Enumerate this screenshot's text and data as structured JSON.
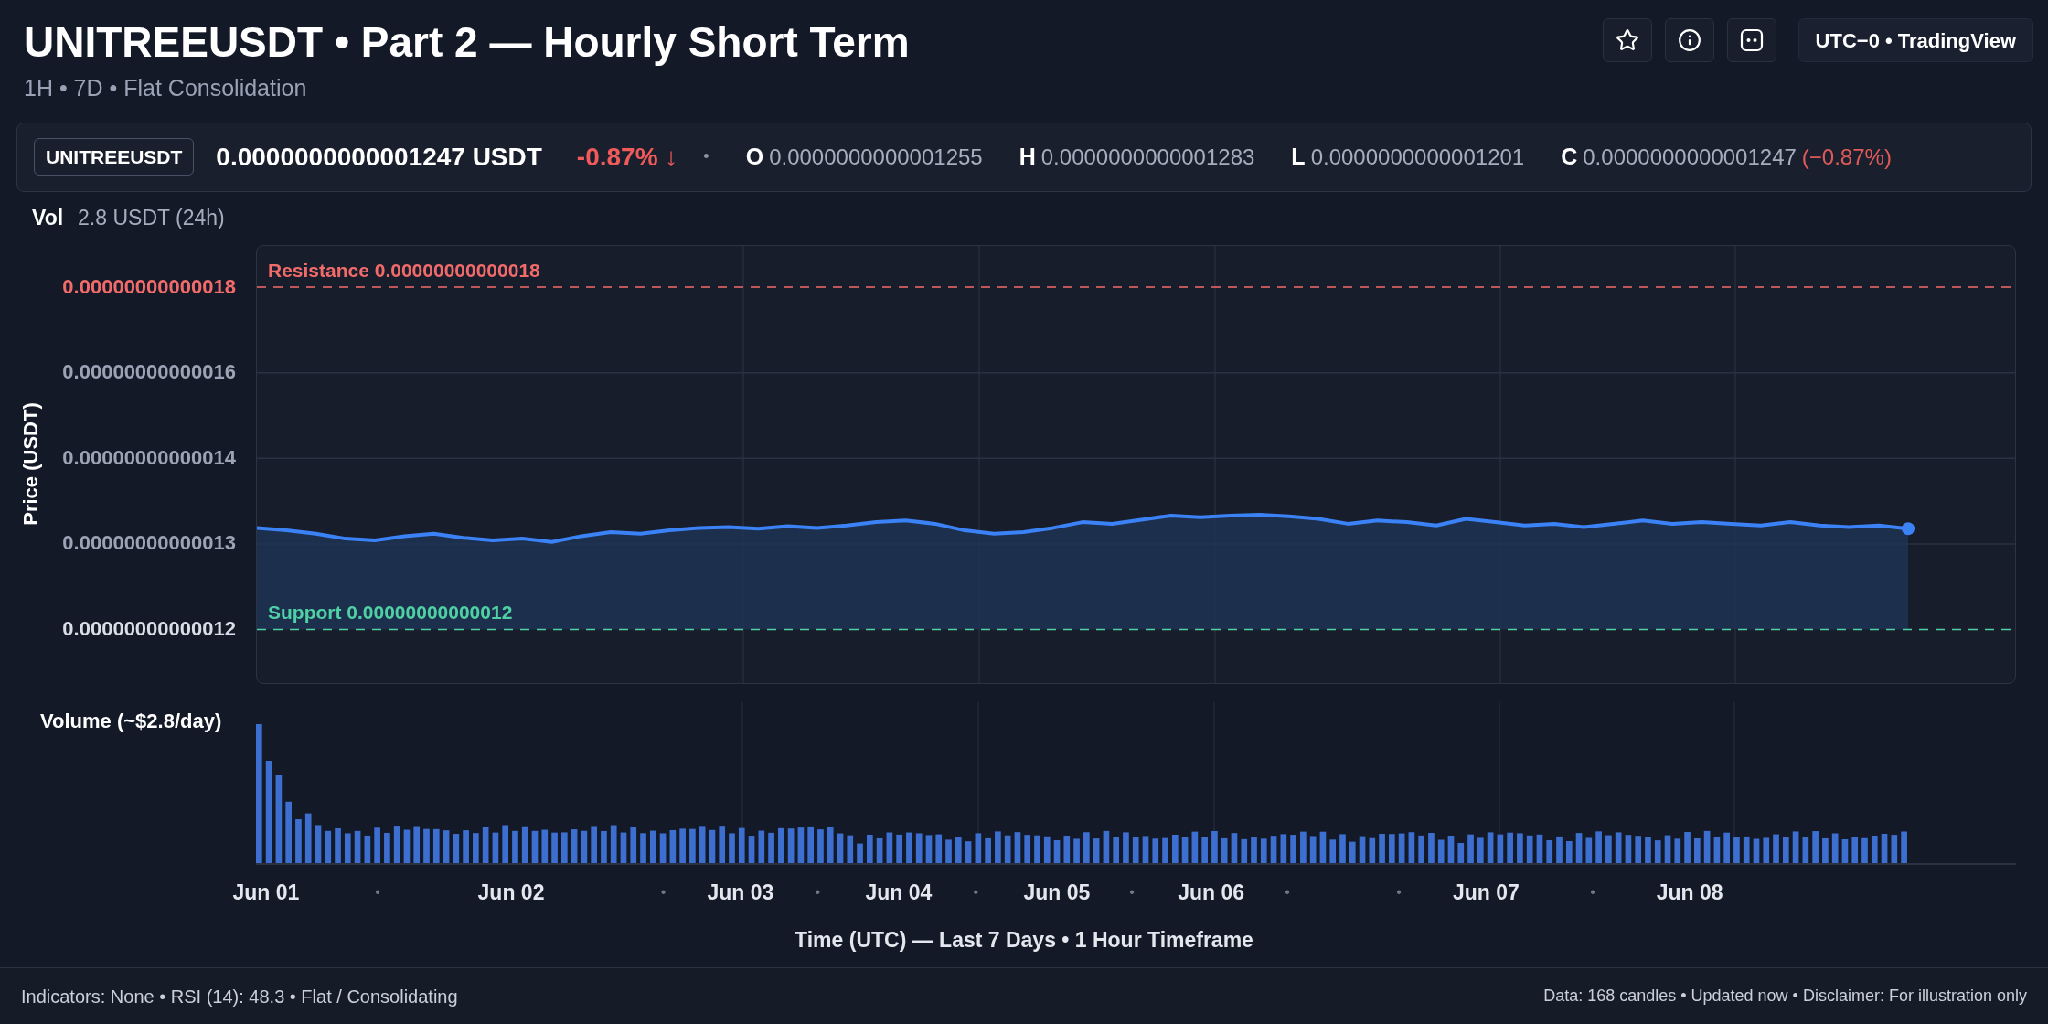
{
  "header": {
    "title": "UNITREEUSDT • Part 2 — Hourly Short Term",
    "subtitle": "1H • 7D • Flat Consolidation",
    "timezone_label": "UTC−0 • TradingView"
  },
  "ticker": {
    "symbol": "UNITREEUSDT",
    "price": "0.0000000000001247 USDT",
    "change": "-0.87% ↓",
    "separator": "•",
    "ohlc": [
      {
        "key": "O",
        "value": "0.0000000000001255"
      },
      {
        "key": "H",
        "value": "0.0000000000001283"
      },
      {
        "key": "L",
        "value": "0.0000000000001201"
      },
      {
        "key": "C",
        "value": "0.0000000000001247",
        "change": "(−0.87%)"
      }
    ]
  },
  "volume_summary": {
    "label": "Vol",
    "value": "2.8 USDT (24h)"
  },
  "price_chart": {
    "y_axis_title": "Price (USDT)",
    "y_labels": [
      {
        "label": "0.00000000000018",
        "color": "#f26b6b"
      },
      {
        "label": "0.00000000000016",
        "color": "#9ca3b4"
      },
      {
        "label": "0.00000000000014",
        "color": "#9ca3b4"
      },
      {
        "label": "0.00000000000013",
        "color": "#9ca3b4"
      },
      {
        "label": "0.00000000000012",
        "color": "#d9dde6"
      }
    ],
    "levels": [
      {
        "kind": "resistance",
        "label": "Resistance",
        "value": "0.00000000000018",
        "color": "#f26b6b"
      },
      {
        "kind": "support",
        "label": "Support",
        "value": "0.00000000000012",
        "color": "#4fd1a5"
      }
    ],
    "x_labels": [
      "Jun 01",
      "Jun 02",
      "Jun 03",
      "Jun 04",
      "Jun 05",
      "Jun 06",
      "Jun 07",
      "Jun 08"
    ],
    "x_markers": [
      "•",
      "•",
      "•",
      "•",
      "•",
      "•",
      "•",
      "•"
    ],
    "x_axis_title": "Time (UTC) — Last 7 Days • 1 Hour Timeframe"
  },
  "volume_panel": {
    "label": "Volume (~$2.8/day)"
  },
  "footer": {
    "left": "Indicators: None • RSI (14): 48.3 • Flat / Consolidating",
    "right": "Data: 168 candles • Updated now • Disclaimer: For illustration only"
  }
}
